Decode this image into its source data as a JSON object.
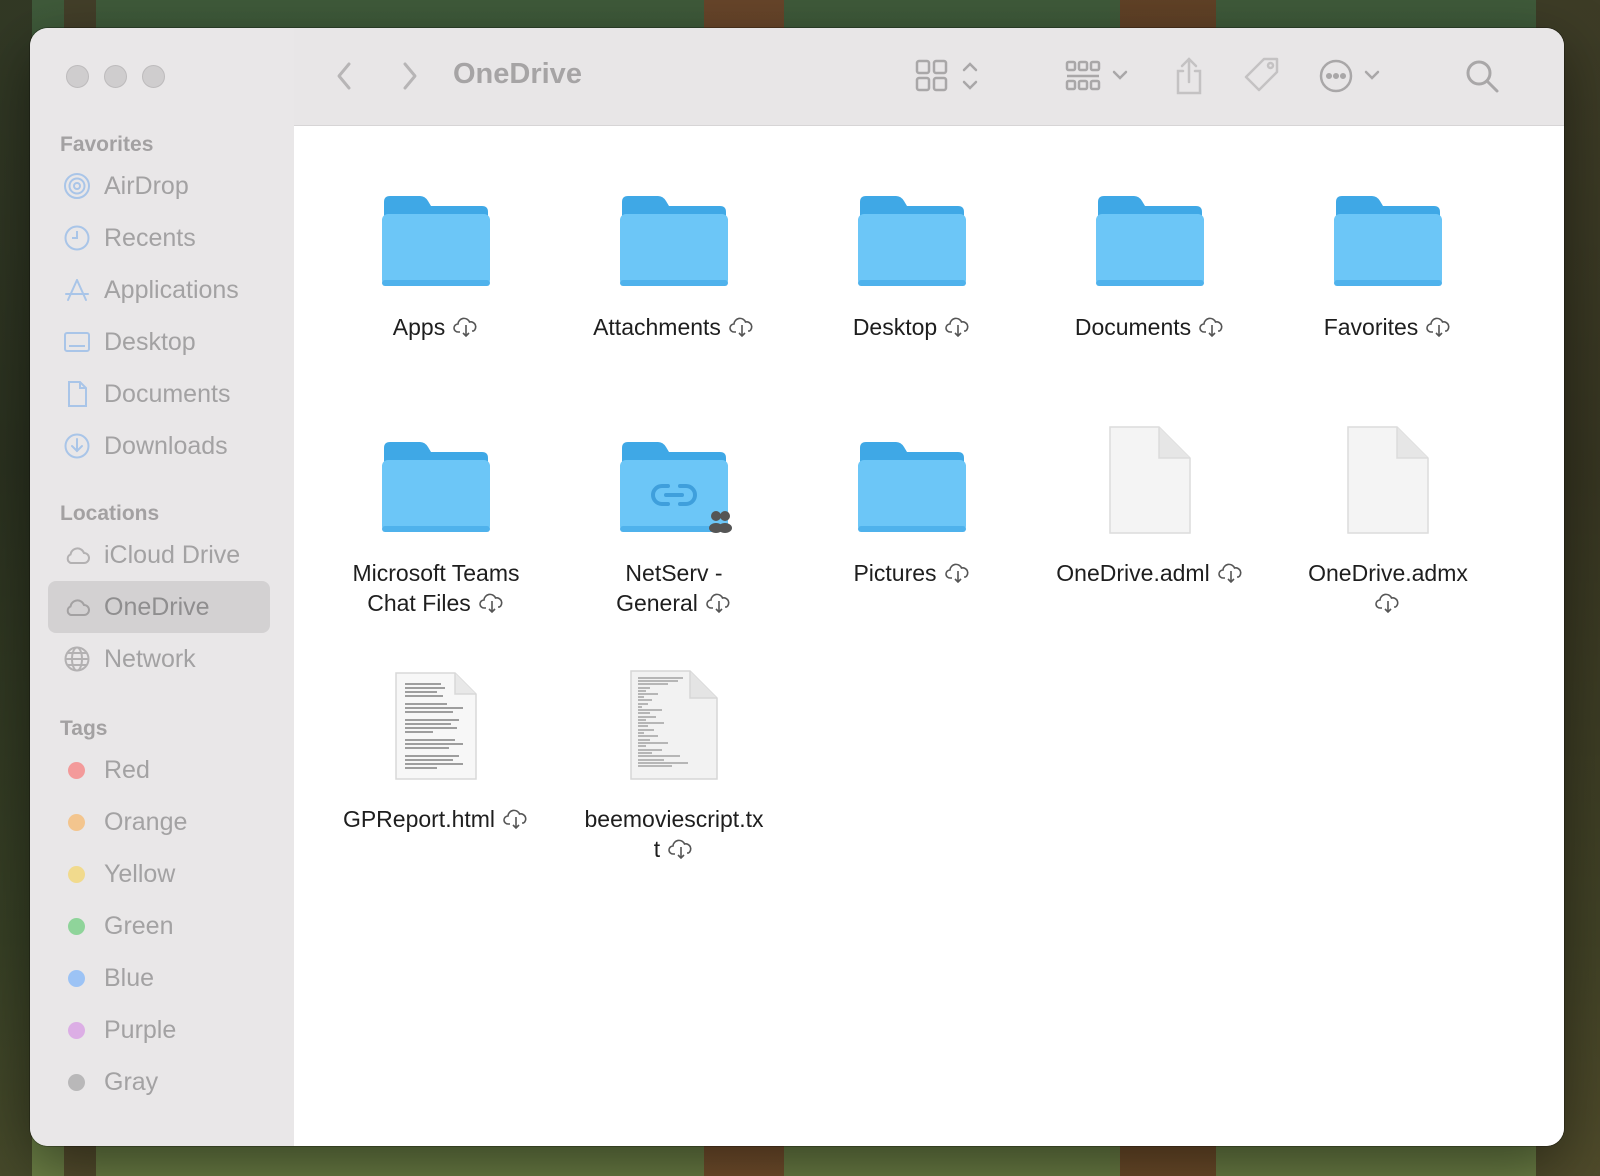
{
  "window": {
    "title": "OneDrive"
  },
  "sidebar": {
    "favorites_header": "Favorites",
    "favorites": [
      {
        "label": "AirDrop",
        "icon": "airdrop-icon"
      },
      {
        "label": "Recents",
        "icon": "clock-icon"
      },
      {
        "label": "Applications",
        "icon": "applications-icon"
      },
      {
        "label": "Desktop",
        "icon": "desktop-icon"
      },
      {
        "label": "Documents",
        "icon": "document-icon"
      },
      {
        "label": "Downloads",
        "icon": "download-icon"
      }
    ],
    "locations_header": "Locations",
    "locations": [
      {
        "label": "iCloud Drive",
        "icon": "cloud-icon"
      },
      {
        "label": "OneDrive",
        "icon": "cloud-icon",
        "selected": true
      },
      {
        "label": "Network",
        "icon": "globe-icon"
      }
    ],
    "tags_header": "Tags",
    "tags": [
      {
        "label": "Red",
        "color": "#f39a9a"
      },
      {
        "label": "Orange",
        "color": "#f3c58e"
      },
      {
        "label": "Yellow",
        "color": "#f1da8d"
      },
      {
        "label": "Green",
        "color": "#8fd49a"
      },
      {
        "label": "Blue",
        "color": "#9cc3f5"
      },
      {
        "label": "Purple",
        "color": "#dcaee5"
      },
      {
        "label": "Gray",
        "color": "#b9b8b9"
      }
    ]
  },
  "files": [
    {
      "line1": "Apps",
      "line2": "",
      "kind": "folder"
    },
    {
      "line1": "Attachments",
      "line2": "",
      "kind": "folder"
    },
    {
      "line1": "Desktop",
      "line2": "",
      "kind": "folder"
    },
    {
      "line1": "Documents",
      "line2": "",
      "kind": "folder"
    },
    {
      "line1": "Favorites",
      "line2": "",
      "kind": "folder"
    },
    {
      "line1": "Microsoft Teams",
      "line2": "Chat Files",
      "kind": "folder"
    },
    {
      "line1": "NetServ -",
      "line2": "General",
      "kind": "shared-folder"
    },
    {
      "line1": "Pictures",
      "line2": "",
      "kind": "folder"
    },
    {
      "line1": "OneDrive.adml",
      "line2": "",
      "kind": "document"
    },
    {
      "line1": "OneDrive.admx",
      "line2": "",
      "kind": "document"
    },
    {
      "line1": "GPReport.html",
      "line2": "",
      "kind": "html-document"
    },
    {
      "line1": "beemoviescript.tx",
      "line2": "t",
      "kind": "text-document"
    }
  ],
  "colors": {
    "folder": "#6cc6f7",
    "folder_tab": "#3fa8e6",
    "selection": "#d3d1d2"
  }
}
